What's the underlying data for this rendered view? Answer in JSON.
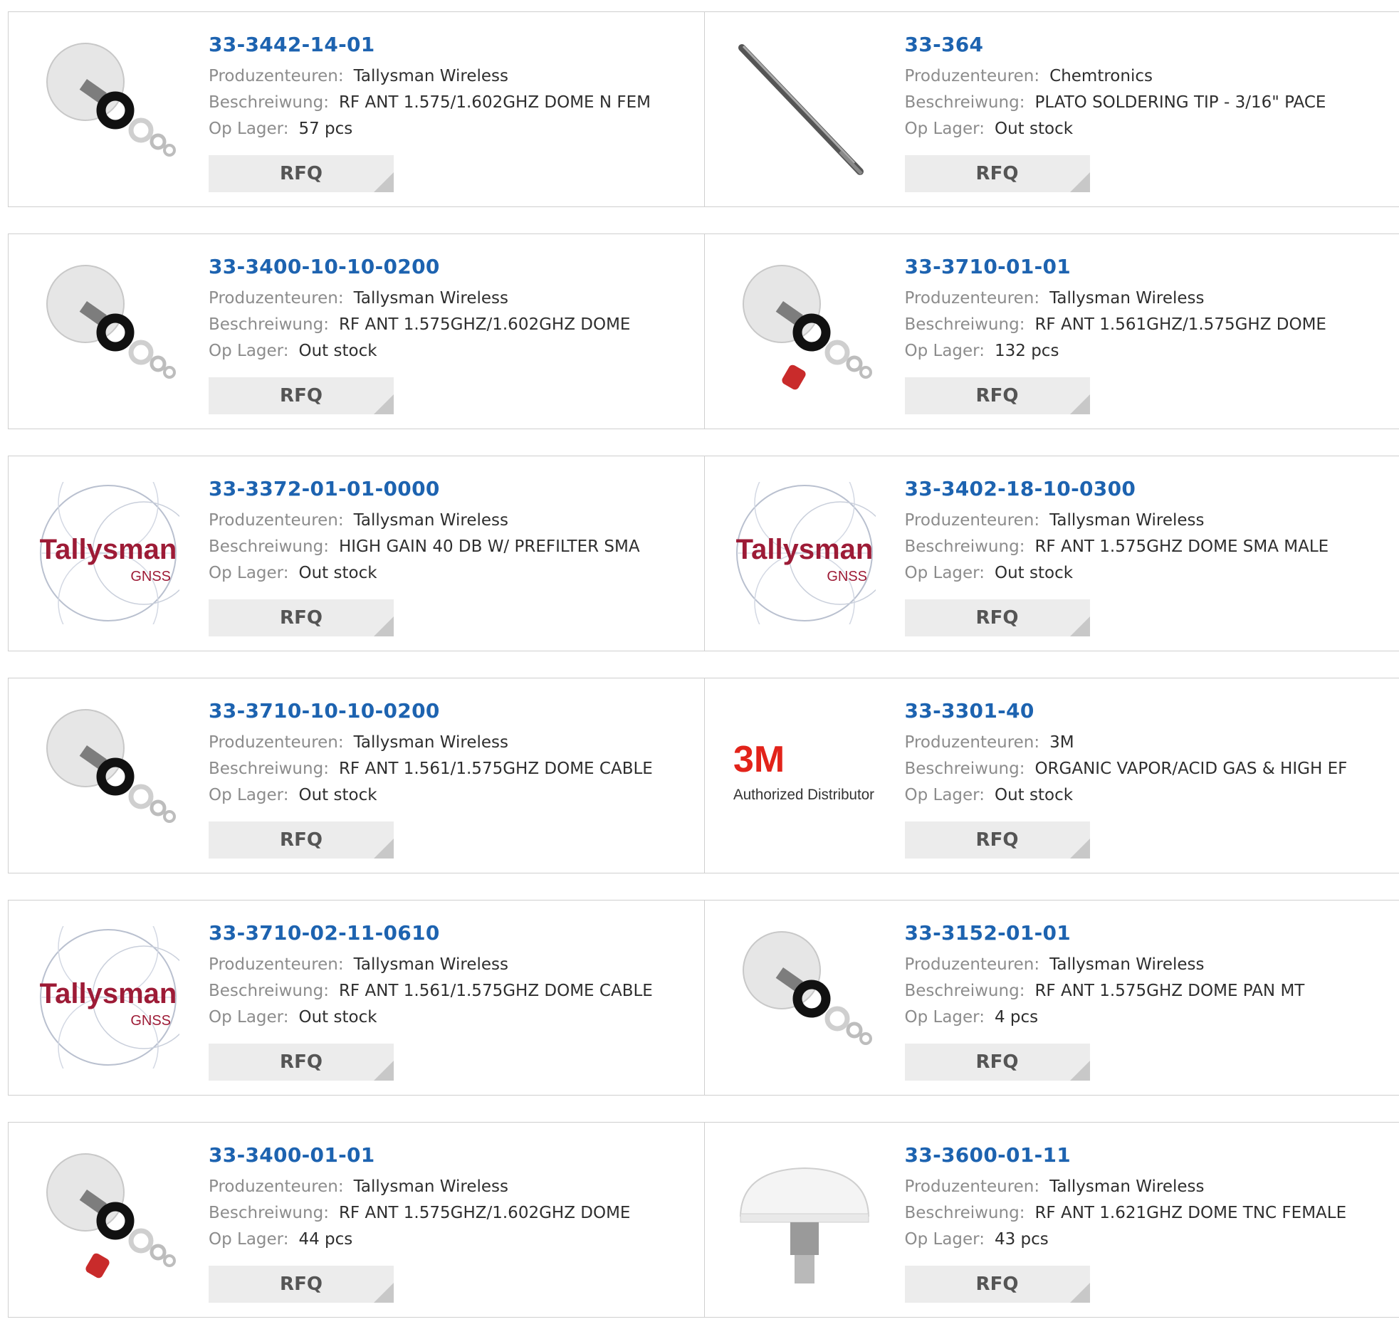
{
  "labels": {
    "manufacturer": "Produzenteuren:",
    "description": "Beschreiwung:",
    "stock": "Op Lager:",
    "rfq": "RFQ"
  },
  "colors": {
    "part_link": "#1d63b0",
    "label": "#8c8c8c",
    "value": "#2e2e2e",
    "button_bg": "#ececec",
    "border": "#cfcfcf"
  },
  "rows": [
    {
      "items": [
        {
          "part": "33-3442-14-01",
          "manufacturer": "Tallysman Wireless",
          "description": "RF ANT 1.575/1.602GHZ DOME N FEM",
          "stock": "57 pcs",
          "image": "antenna-kit-image"
        },
        {
          "part": "33-364",
          "manufacturer": "Chemtronics",
          "description": "PLATO SOLDERING TIP - 3/16\" PACE",
          "stock": "Out stock",
          "image": "soldering-tip-image"
        }
      ]
    },
    {
      "items": [
        {
          "part": "33-3400-10-10-0200",
          "manufacturer": "Tallysman Wireless",
          "description": "RF ANT 1.575GHZ/1.602GHZ DOME",
          "stock": "Out stock",
          "image": "antenna-kit-image"
        },
        {
          "part": "33-3710-01-01",
          "manufacturer": "Tallysman Wireless",
          "description": "RF ANT 1.561GHZ/1.575GHZ DOME",
          "stock": "132 pcs",
          "image": "antenna-kit-cap-image"
        }
      ]
    },
    {
      "items": [
        {
          "part": "33-3372-01-01-0000",
          "manufacturer": "Tallysman Wireless",
          "description": "HIGH GAIN 40 DB W/ PREFILTER SMA",
          "stock": "Out stock",
          "image": "tallysman-logo"
        },
        {
          "part": "33-3402-18-10-0300",
          "manufacturer": "Tallysman Wireless",
          "description": "RF ANT 1.575GHZ DOME SMA MALE",
          "stock": "Out stock",
          "image": "tallysman-logo"
        }
      ]
    },
    {
      "items": [
        {
          "part": "33-3710-10-10-0200",
          "manufacturer": "Tallysman Wireless",
          "description": "RF ANT 1.561/1.575GHZ DOME CABLE",
          "stock": "Out stock",
          "image": "antenna-kit-image"
        },
        {
          "part": "33-3301-40",
          "manufacturer": "3M",
          "description": "ORGANIC VAPOR/ACID GAS & HIGH EF",
          "stock": "Out stock",
          "image": "3m-logo"
        }
      ]
    },
    {
      "items": [
        {
          "part": "33-3710-02-11-0610",
          "manufacturer": "Tallysman Wireless",
          "description": "RF ANT 1.561/1.575GHZ DOME CABLE",
          "stock": "Out stock",
          "image": "tallysman-logo"
        },
        {
          "part": "33-3152-01-01",
          "manufacturer": "Tallysman Wireless",
          "description": "RF ANT 1.575GHZ DOME PAN MT",
          "stock": "4 pcs",
          "image": "antenna-kit-image"
        }
      ]
    },
    {
      "items": [
        {
          "part": "33-3400-01-01",
          "manufacturer": "Tallysman Wireless",
          "description": "RF ANT 1.575GHZ/1.602GHZ DOME",
          "stock": "44 pcs",
          "image": "antenna-kit-cap-image"
        },
        {
          "part": "33-3600-01-11",
          "manufacturer": "Tallysman Wireless",
          "description": "RF ANT 1.621GHZ DOME TNC FEMALE",
          "stock": "43 pcs",
          "image": "dome-antenna-image"
        }
      ]
    }
  ],
  "logo_text": {
    "tallysman": "Tallysman",
    "gnss": "GNSS",
    "three_m": "3M",
    "authorized": "Authorized Distributor"
  }
}
